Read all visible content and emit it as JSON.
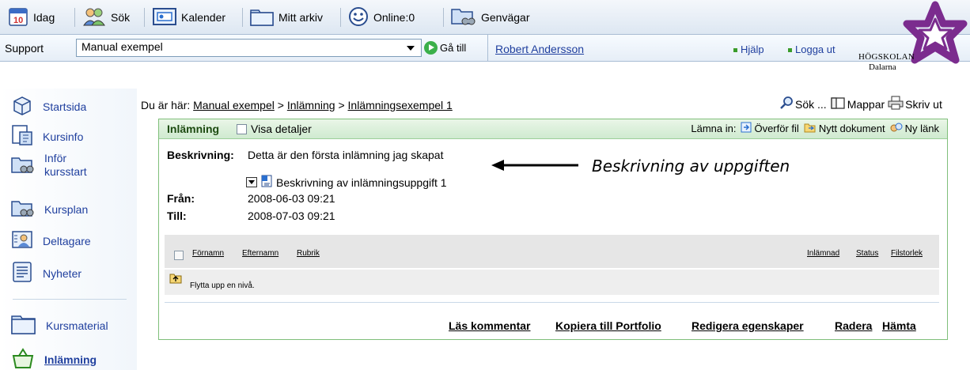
{
  "toolbar": {
    "items": [
      {
        "label": "Idag",
        "icon": "calendar-day-icon"
      },
      {
        "label": "Sök",
        "icon": "people-search-icon"
      },
      {
        "label": "Kalender",
        "icon": "calendar-icon"
      },
      {
        "label": "Mitt arkiv",
        "icon": "folder-icon"
      },
      {
        "label": "Online:0",
        "icon": "smiley-icon"
      },
      {
        "label": "Genvägar",
        "icon": "shortcut-folder-icon"
      }
    ],
    "day_number": "10"
  },
  "navbar": {
    "support_label": "Support",
    "selected_course": "Manual exempel",
    "goto_label": "Gå till",
    "user_name": "Robert Andersson",
    "help_label": "Hjälp",
    "logout_label": "Logga ut"
  },
  "logo": {
    "line1": "HÖGSKOLAN",
    "line2": "Dalarna",
    "color": "#7b2c8e"
  },
  "sidebar": {
    "items": [
      {
        "label": "Startsida",
        "icon": "cube-icon"
      },
      {
        "label": "Kursinfo",
        "icon": "info-doc-icon"
      },
      {
        "label": "Inför kursstart",
        "icon": "link-folder-icon"
      },
      {
        "label": "Kursplan",
        "icon": "plan-folder-icon"
      },
      {
        "label": "Deltagare",
        "icon": "participants-icon"
      },
      {
        "label": "Nyheter",
        "icon": "news-icon"
      },
      {
        "label": "Kursmaterial",
        "icon": "folder-icon"
      },
      {
        "label": "Inlämning",
        "icon": "submission-basket-icon"
      }
    ]
  },
  "breadcrumb": {
    "prefix": "Du är här:",
    "items": [
      "Manual exempel",
      "Inlämning",
      "Inlämningsexempel 1"
    ],
    "separator": ">"
  },
  "tools": {
    "search": "Sök ...",
    "folders": "Mappar",
    "print": "Skriv ut"
  },
  "panel": {
    "title": "Inlämning",
    "show_details": "Visa detaljer",
    "submit_prefix": "Lämna in:",
    "actions": [
      "Överför fil",
      "Nytt dokument",
      "Ny länk"
    ],
    "description_label": "Beskrivning:",
    "description_text": "Detta är den första inlämning jag skapat",
    "attachment": "Beskrivning av inlämningsuppgift 1",
    "from_label": "Från:",
    "from_value": "2008-06-03 09:21",
    "to_label": "Till:",
    "to_value": "2008-07-03 09:21"
  },
  "table": {
    "columns": [
      "Förnamn",
      "Efternamn",
      "Rubrik",
      "Inlämnad",
      "Status",
      "Filstorlek"
    ],
    "up_row": "Flytta upp en nivå."
  },
  "footer": {
    "links": [
      "Läs kommentar",
      "Kopiera till Portfolio",
      "Redigera egenskaper",
      "Radera",
      "Hämta"
    ]
  },
  "annotation": "Beskrivning av uppgiften",
  "colors": {
    "accent_green": "#7fbf7a",
    "link_blue": "#1f3f9e"
  }
}
